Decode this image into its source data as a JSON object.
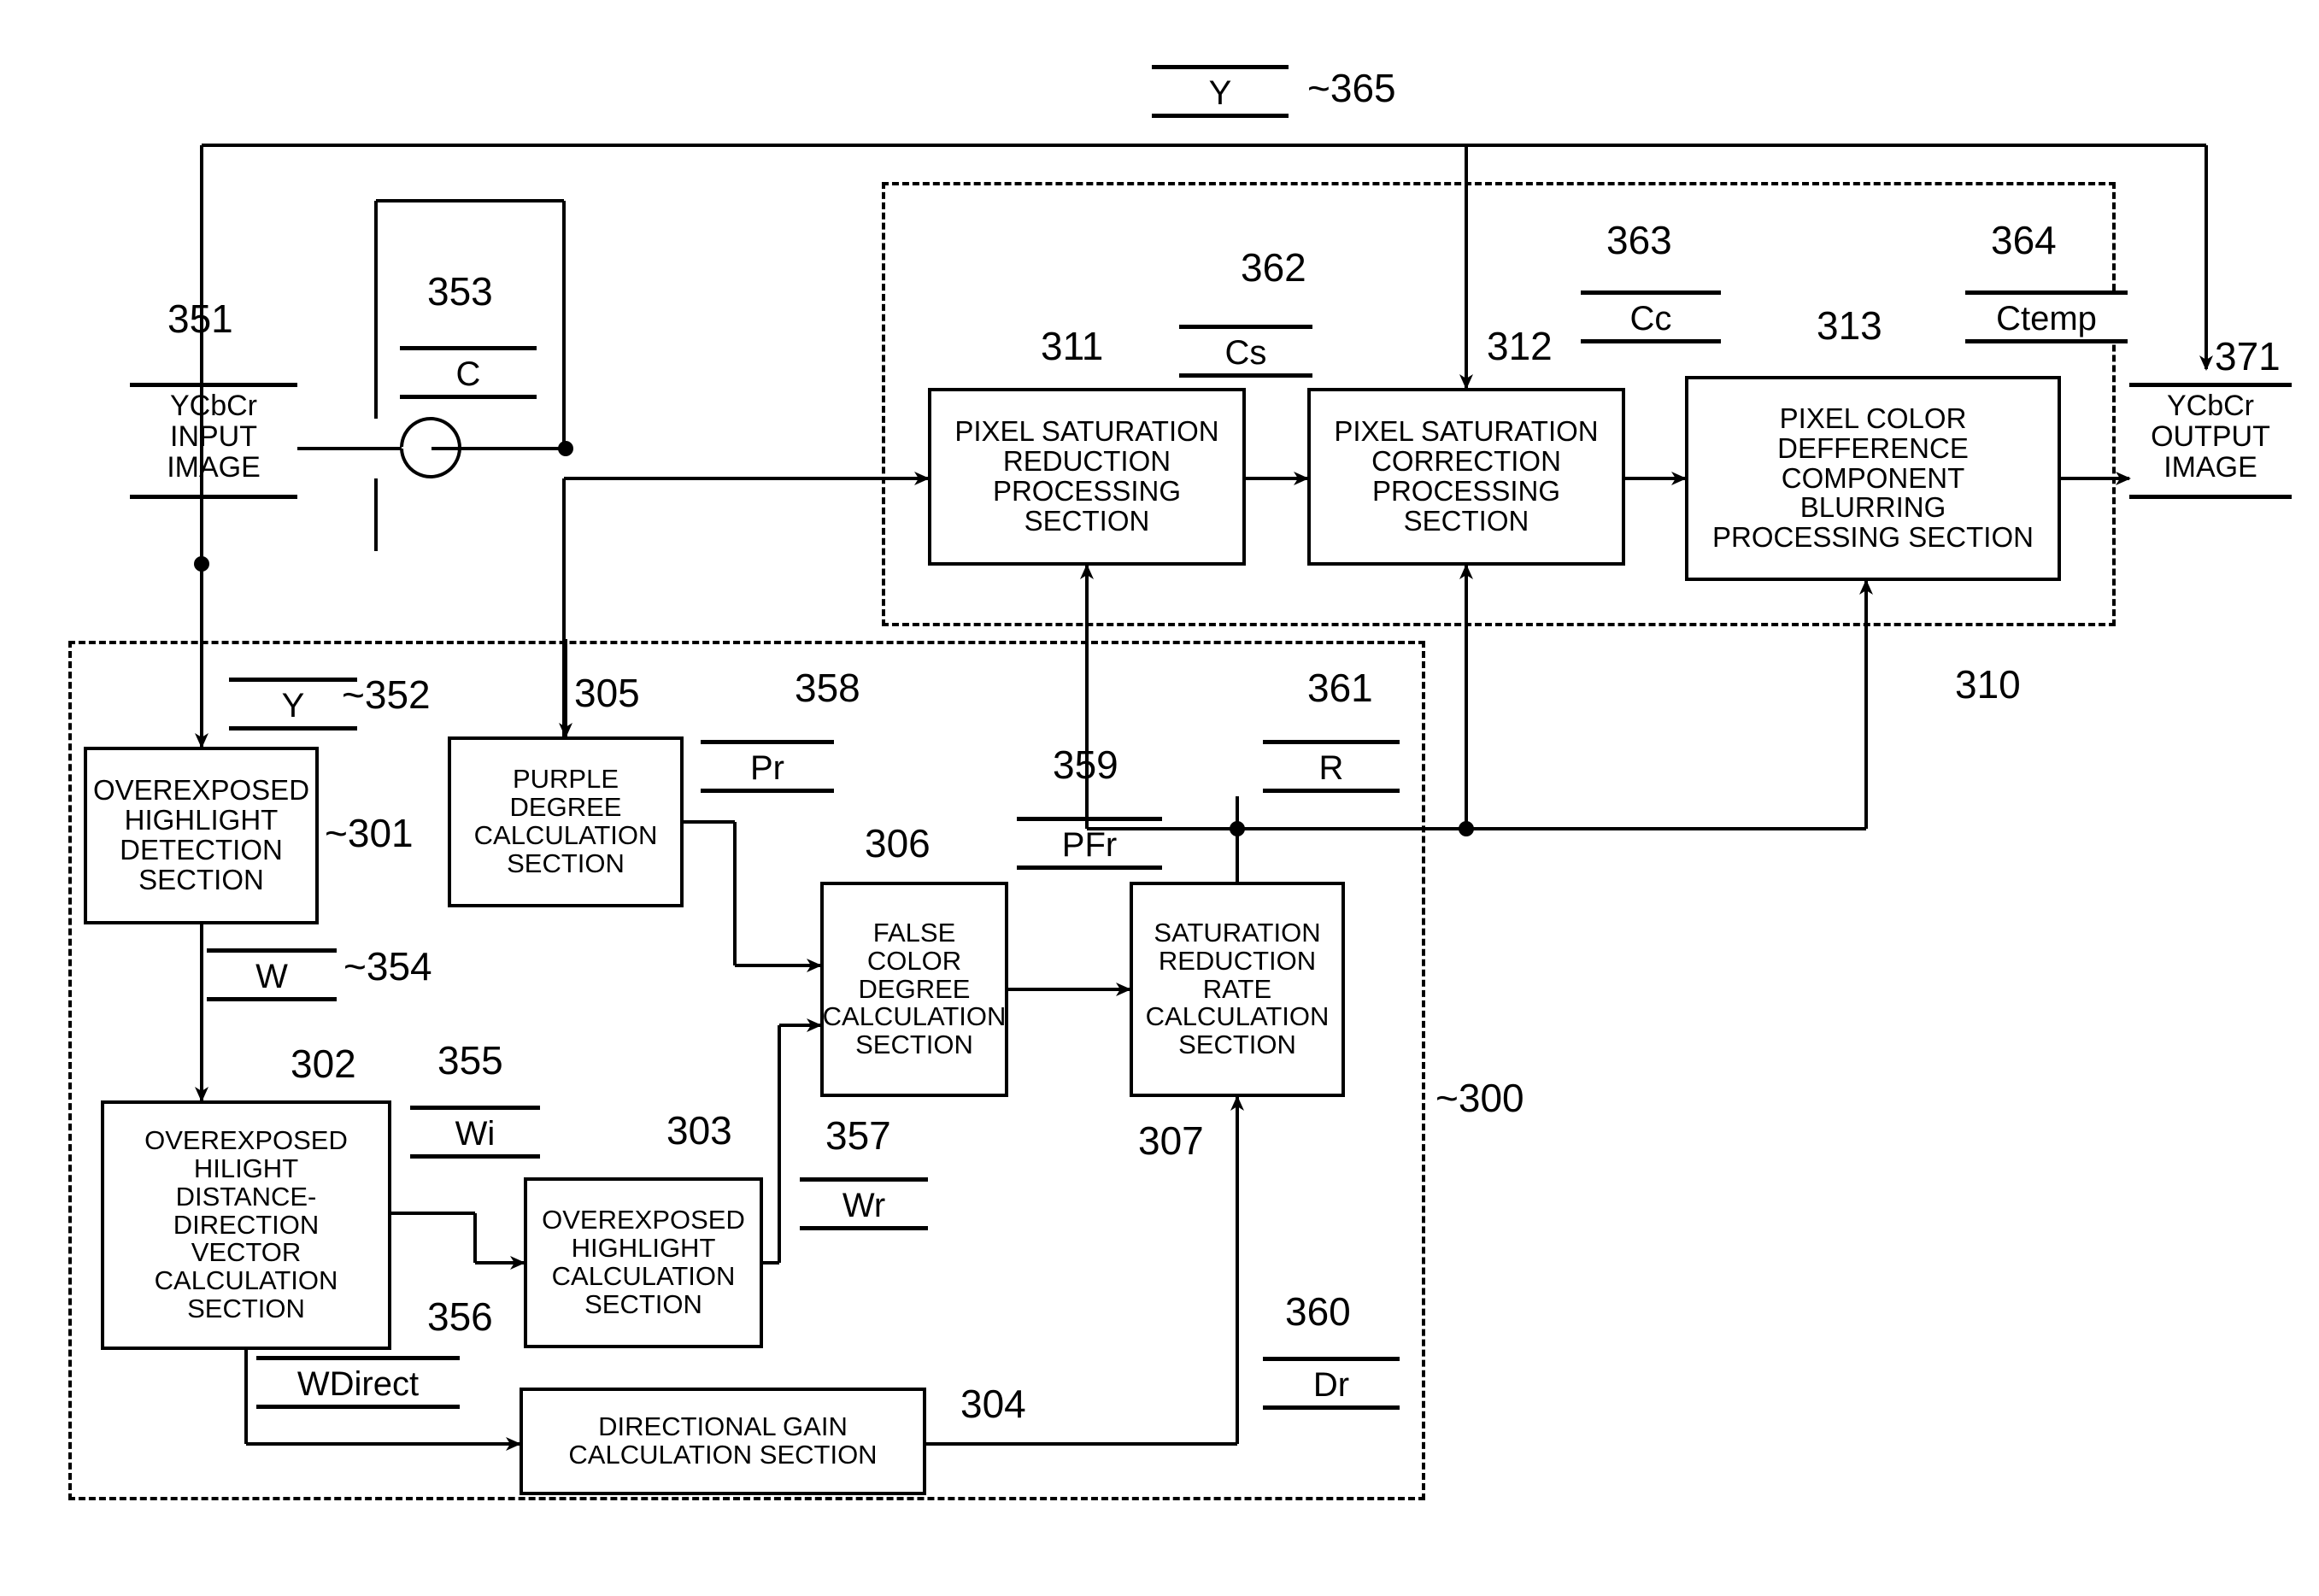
{
  "figure": {
    "blocks": [
      {
        "id": "301",
        "label": "OVEREXPOSED\nHIGHLIGHT\nDETECTION\nSECTION"
      },
      {
        "id": "302",
        "label": "OVEREXPOSED\nHILIGHT\nDISTANCE-\nDIRECTION\nVECTOR\nCALCULATION\nSECTION"
      },
      {
        "id": "303",
        "label": "OVEREXPOSED\nHIGHLIGHT\nCALCULATION\nSECTION"
      },
      {
        "id": "304",
        "label": "DIRECTIONAL GAIN\nCALCULATION SECTION"
      },
      {
        "id": "305",
        "label": "PURPLE\nDEGREE\nCALCULATION\nSECTION"
      },
      {
        "id": "306",
        "label": "FALSE\nCOLOR\nDEGREE\nCALCULATION\nSECTION"
      },
      {
        "id": "307",
        "label": "SATURATION\nREDUCTION\nRATE\nCALCULATION\nSECTION"
      },
      {
        "id": "311",
        "label": "PIXEL SATURATION\nREDUCTION\nPROCESSING\nSECTION"
      },
      {
        "id": "312",
        "label": "PIXEL SATURATION\nCORRECTION\nPROCESSING\nSECTION"
      },
      {
        "id": "313",
        "label": "PIXEL COLOR\nDEFFERENCE\nCOMPONENT\nBLURRING\nPROCESSING SECTION"
      }
    ],
    "terminals": [
      {
        "id": "351",
        "label": "YCbCr\nINPUT\nIMAGE"
      },
      {
        "id": "371",
        "label": "YCbCr\nOUTPUT\nIMAGE"
      }
    ],
    "signals": [
      {
        "id": "352",
        "label": "Y"
      },
      {
        "id": "353",
        "label": "C"
      },
      {
        "id": "354",
        "label": "W"
      },
      {
        "id": "355",
        "label": "Wi"
      },
      {
        "id": "356",
        "label": "WDirect"
      },
      {
        "id": "357",
        "label": "Wr"
      },
      {
        "id": "358",
        "label": "Pr"
      },
      {
        "id": "359",
        "label": "PFr"
      },
      {
        "id": "360",
        "label": "Dr"
      },
      {
        "id": "361",
        "label": "R"
      },
      {
        "id": "362",
        "label": "Cs"
      },
      {
        "id": "363",
        "label": "Cc"
      },
      {
        "id": "364",
        "label": "Ctemp"
      },
      {
        "id": "365",
        "label": "Y"
      }
    ],
    "containers": [
      {
        "id": "300"
      },
      {
        "id": "310"
      }
    ],
    "refs": {
      "r300": "~300",
      "r301": "~301",
      "r302": "302",
      "r303": "303",
      "r304": "304",
      "r305": "305",
      "r306": "306",
      "r307": "307",
      "r310": "310",
      "r311": "311",
      "r312": "312",
      "r313": "313",
      "r351": "351",
      "r352": "~352",
      "r353": "353",
      "r354": "~354",
      "r355": "355",
      "r356": "356",
      "r357": "357",
      "r358": "358",
      "r359": "359",
      "r360": "360",
      "r361": "361",
      "r362": "362",
      "r363": "363",
      "r364": "364",
      "r365": "~365",
      "r371": "371"
    }
  }
}
